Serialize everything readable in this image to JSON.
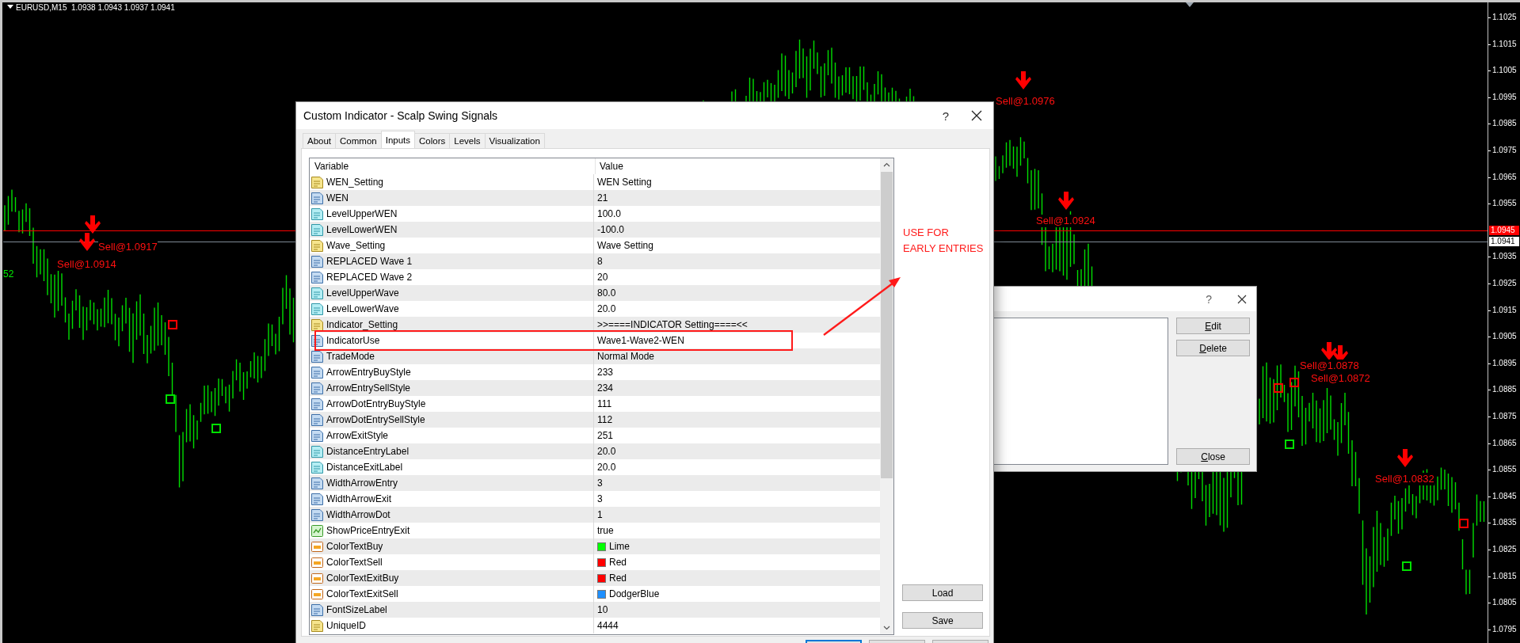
{
  "chart": {
    "title": "EURUSD,M15  1.0938 1.0943 1.0937 1.0941",
    "side_value": "52",
    "price_axis": [
      "1.1025",
      "1.1015",
      "1.1005",
      "1.0995",
      "1.0985",
      "1.0975",
      "1.0965",
      "1.0955",
      "1.0935",
      "1.0925",
      "1.0915",
      "1.0905",
      "1.0895",
      "1.0885",
      "1.0875",
      "1.0865",
      "1.0855",
      "1.0845",
      "1.0835",
      "1.0825",
      "1.0815",
      "1.0805",
      "1.0795"
    ],
    "price_tags": [
      {
        "kind": "ask",
        "text": "1.0945"
      },
      {
        "kind": "bid",
        "text": "1.0941"
      }
    ],
    "signals": [
      {
        "kind": "sell",
        "label": "Sell@1.0917"
      },
      {
        "kind": "sell",
        "label": "Sell@1.0914"
      },
      {
        "kind": "sell",
        "label": "Sell@1.0976"
      },
      {
        "kind": "sell",
        "label": "Sell@1.0924"
      },
      {
        "kind": "sell",
        "label": "Sell@1.0878"
      },
      {
        "kind": "sell",
        "label": "Sell@1.0872"
      },
      {
        "kind": "sell",
        "label": "Sell@1.0832"
      }
    ],
    "markers": [
      {
        "color": "#ff0000"
      },
      {
        "color": "#00e000"
      },
      {
        "color": "#00e000"
      },
      {
        "color": "#ff0000"
      },
      {
        "color": "#ff0000"
      },
      {
        "color": "#00e000"
      },
      {
        "color": "#00e000"
      },
      {
        "color": "#ff0000"
      }
    ]
  },
  "annotation": {
    "lines": [
      "USE FOR",
      "EARLY ENTRIES"
    ]
  },
  "back_dialog": {
    "help": "?",
    "buttons": [
      "Edit",
      "Delete",
      "Close"
    ]
  },
  "dialog": {
    "title": "Custom Indicator - Scalp Swing Signals",
    "help": "?",
    "tabs": [
      {
        "label": "About",
        "selected": false
      },
      {
        "label": "Common",
        "selected": false
      },
      {
        "label": "Inputs",
        "selected": true
      },
      {
        "label": "Colors",
        "selected": false
      },
      {
        "label": "Levels",
        "selected": false
      },
      {
        "label": "Visualization",
        "selected": false
      }
    ],
    "table": {
      "columns": [
        "Variable",
        "Value"
      ],
      "rows": [
        {
          "kind": "string",
          "variable": "WEN_Setting",
          "value": "WEN Setting",
          "highlighted": false
        },
        {
          "kind": "int",
          "variable": "WEN",
          "value": "21",
          "highlighted": false
        },
        {
          "kind": "double",
          "variable": "LevelUpperWEN",
          "value": "100.0",
          "highlighted": false
        },
        {
          "kind": "double",
          "variable": "LevelLowerWEN",
          "value": "-100.0",
          "highlighted": false
        },
        {
          "kind": "string",
          "variable": "Wave_Setting",
          "value": "Wave Setting",
          "highlighted": false
        },
        {
          "kind": "int",
          "variable": "REPLACED Wave 1",
          "value": "8",
          "highlighted": false
        },
        {
          "kind": "int",
          "variable": "REPLACED Wave 2",
          "value": "20",
          "highlighted": false
        },
        {
          "kind": "double",
          "variable": "LevelUpperWave",
          "value": "80.0",
          "highlighted": false
        },
        {
          "kind": "double",
          "variable": "LevelLowerWave",
          "value": "20.0",
          "highlighted": false
        },
        {
          "kind": "string",
          "variable": "Indicator_Setting",
          "value": ">>====INDICATOR Setting====<<",
          "highlighted": false
        },
        {
          "kind": "int",
          "variable": "IndicatorUse",
          "value": "Wave1-Wave2-WEN",
          "highlighted": true
        },
        {
          "kind": "int",
          "variable": "TradeMode",
          "value": "Normal Mode",
          "highlighted": false
        },
        {
          "kind": "int",
          "variable": "ArrowEntryBuyStyle",
          "value": "233",
          "highlighted": false
        },
        {
          "kind": "int",
          "variable": "ArrowEntrySellStyle",
          "value": "234",
          "highlighted": false
        },
        {
          "kind": "int",
          "variable": "ArrowDotEntryBuyStyle",
          "value": "111",
          "highlighted": false
        },
        {
          "kind": "int",
          "variable": "ArrowDotEntrySellStyle",
          "value": "112",
          "highlighted": false
        },
        {
          "kind": "int",
          "variable": "ArrowExitStyle",
          "value": "251",
          "highlighted": false
        },
        {
          "kind": "double",
          "variable": "DistanceEntryLabel",
          "value": "20.0",
          "highlighted": false
        },
        {
          "kind": "double",
          "variable": "DistanceExitLabel",
          "value": "20.0",
          "highlighted": false
        },
        {
          "kind": "int",
          "variable": "WidthArrowEntry",
          "value": "3",
          "highlighted": false
        },
        {
          "kind": "int",
          "variable": "WidthArrowExit",
          "value": "3",
          "highlighted": false
        },
        {
          "kind": "int",
          "variable": "WidthArrowDot",
          "value": "1",
          "highlighted": false
        },
        {
          "kind": "bool",
          "variable": "ShowPriceEntryExit",
          "value": "true",
          "highlighted": false
        },
        {
          "kind": "color",
          "variable": "ColorTextBuy",
          "value": "Lime",
          "color": "#00ff00",
          "highlighted": false
        },
        {
          "kind": "color",
          "variable": "ColorTextSell",
          "value": "Red",
          "color": "#ff0000",
          "highlighted": false
        },
        {
          "kind": "color",
          "variable": "ColorTextExitBuy",
          "value": "Red",
          "color": "#ff0000",
          "highlighted": false
        },
        {
          "kind": "color",
          "variable": "ColorTextExitSell",
          "value": "DodgerBlue",
          "color": "#1e90ff",
          "highlighted": false
        },
        {
          "kind": "int",
          "variable": "FontSizeLabel",
          "value": "10",
          "highlighted": false
        },
        {
          "kind": "string",
          "variable": "UniqueID",
          "value": "4444",
          "highlighted": false
        }
      ]
    },
    "side_buttons": [
      "Load",
      "Save"
    ]
  }
}
